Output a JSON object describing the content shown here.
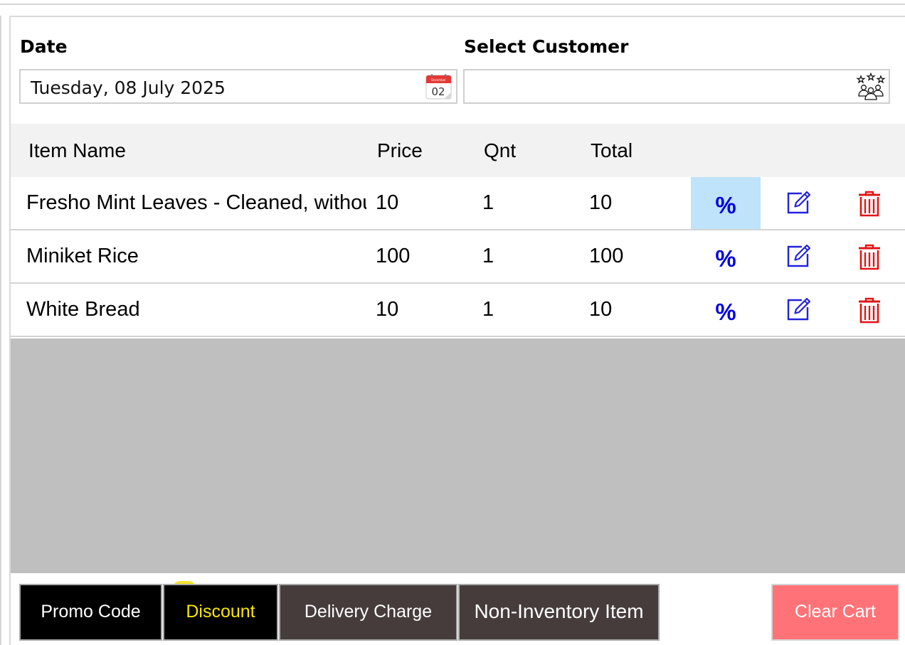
{
  "form": {
    "date_label": "Date",
    "date_value": "Tuesday, 08 July 2025",
    "customer_label": "Select Customer",
    "customer_value": "",
    "calendar_icon": {
      "month": "December",
      "day": "02"
    }
  },
  "table": {
    "headers": {
      "name": "Item Name",
      "price": "Price",
      "qnt": "Qnt",
      "total": "Total"
    },
    "rows": [
      {
        "name": "Fresho Mint Leaves - Cleaned, without Roots",
        "price": "10",
        "qnt": "1",
        "total": "10",
        "discount_symbol": "%"
      },
      {
        "name": "Miniket Rice",
        "price": "100",
        "qnt": "1",
        "total": "100",
        "discount_symbol": "%"
      },
      {
        "name": "White Bread",
        "price": "10",
        "qnt": "1",
        "total": "10",
        "discount_symbol": "%"
      }
    ]
  },
  "actions": {
    "promo_code": "Promo Code",
    "discount": "Discount",
    "delivery_charge": "Delivery Charge",
    "non_inventory_item": "Non-Inventory Item",
    "clear_cart": "Clear Cart"
  },
  "colors": {
    "percent": "#0000dd",
    "percent_active_bg": "#bfe3fb",
    "edit_icon": "#2222dd",
    "delete_icon": "#e01515",
    "clear_cart_bg": "#ff7378",
    "discount_text": "#f7e600",
    "dark_button_bg": "#463c3c"
  },
  "icons": [
    "calendar-icon",
    "customer-group-icon",
    "edit-icon",
    "trash-icon"
  ]
}
